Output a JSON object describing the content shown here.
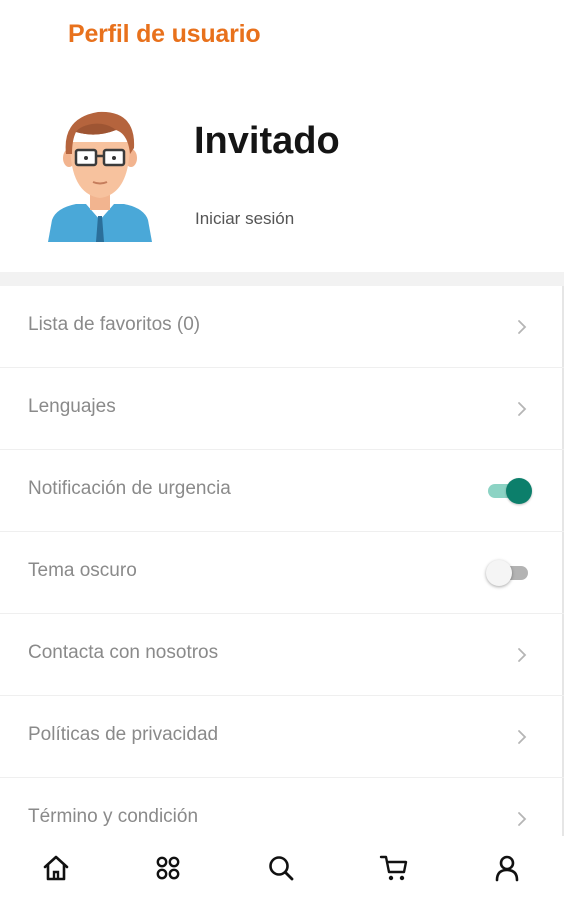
{
  "header": {
    "title": "Perfil de usuario"
  },
  "profile": {
    "name": "Invitado",
    "login_label": "Iniciar sesión"
  },
  "menu": {
    "items": [
      {
        "label": "Lista de favoritos (0)",
        "control": "chevron"
      },
      {
        "label": "Lenguajes",
        "control": "chevron"
      },
      {
        "label": "Notificación de urgencia",
        "control": "toggle",
        "on": true
      },
      {
        "label": "Tema oscuro",
        "control": "toggle",
        "on": false
      },
      {
        "label": "Contacta con nosotros",
        "control": "chevron"
      },
      {
        "label": "Políticas de privacidad",
        "control": "chevron"
      },
      {
        "label": "Término y condición",
        "control": "chevron"
      }
    ]
  },
  "bottom_nav": {
    "items": [
      {
        "icon": "home-icon"
      },
      {
        "icon": "grid-icon"
      },
      {
        "icon": "search-icon"
      },
      {
        "icon": "cart-icon"
      },
      {
        "icon": "user-icon"
      }
    ]
  },
  "colors": {
    "accent": "#e8711c",
    "toggle_on": "#0c7f6b",
    "label_gray": "#8a8a8a"
  }
}
